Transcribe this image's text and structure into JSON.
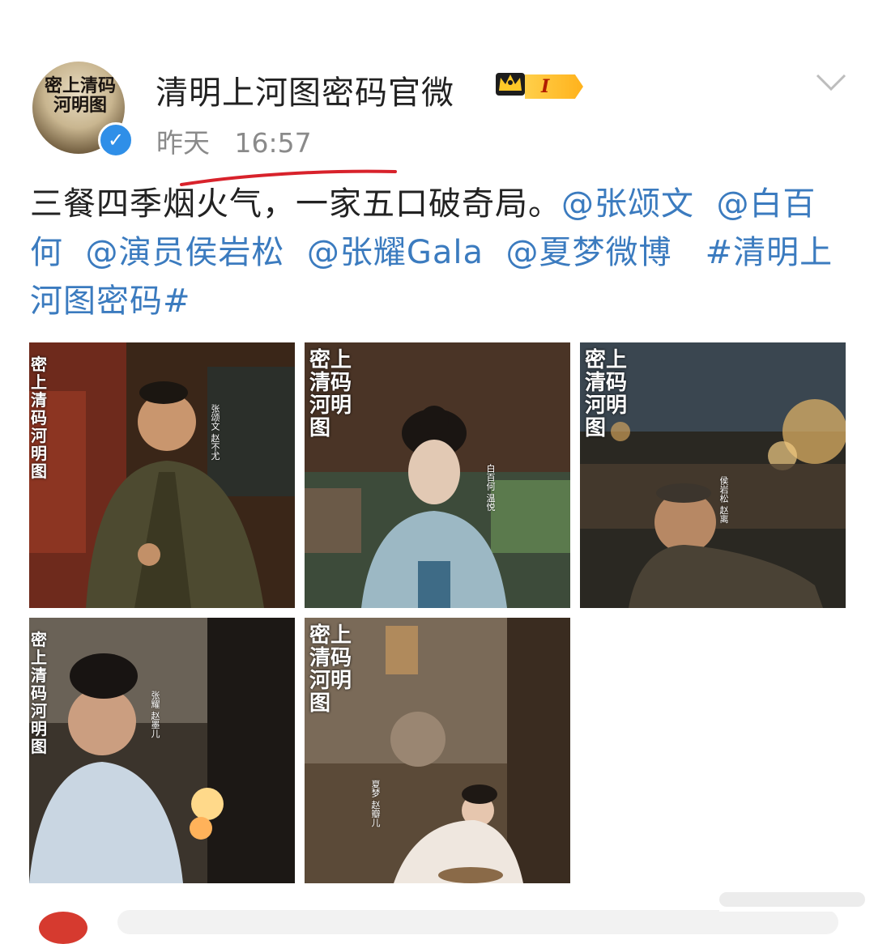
{
  "account": {
    "name": "清明上河图密码官微",
    "avatar_text": "密上清码河明图",
    "vip_level": "I",
    "crown_icon": "crown-icon",
    "verified_icon": "check-icon"
  },
  "post": {
    "date": "昨天",
    "time": "16:57",
    "text_plain": "三餐四季烟火气，一家五口破奇局。",
    "mentions": [
      "@张颂文",
      "@白百何",
      "@演员侯岩松",
      "@张耀Gala",
      "@夏梦微博"
    ],
    "hashtag": "#清明上河图密码#"
  },
  "images": [
    {
      "caption": "张颂文 赵不尤"
    },
    {
      "caption": "白百何 温悦"
    },
    {
      "caption": "侯岩松 赵离"
    },
    {
      "caption": "张耀 赵墨儿"
    },
    {
      "caption": "夏梦 赵瓣儿"
    }
  ],
  "poster_logo": "密上清码河明图",
  "colors": {
    "link": "#3b7bbf",
    "text": "#222222",
    "meta": "#8a8a8a",
    "verified": "#2f8fe8",
    "vip": "#ffbf2e"
  }
}
